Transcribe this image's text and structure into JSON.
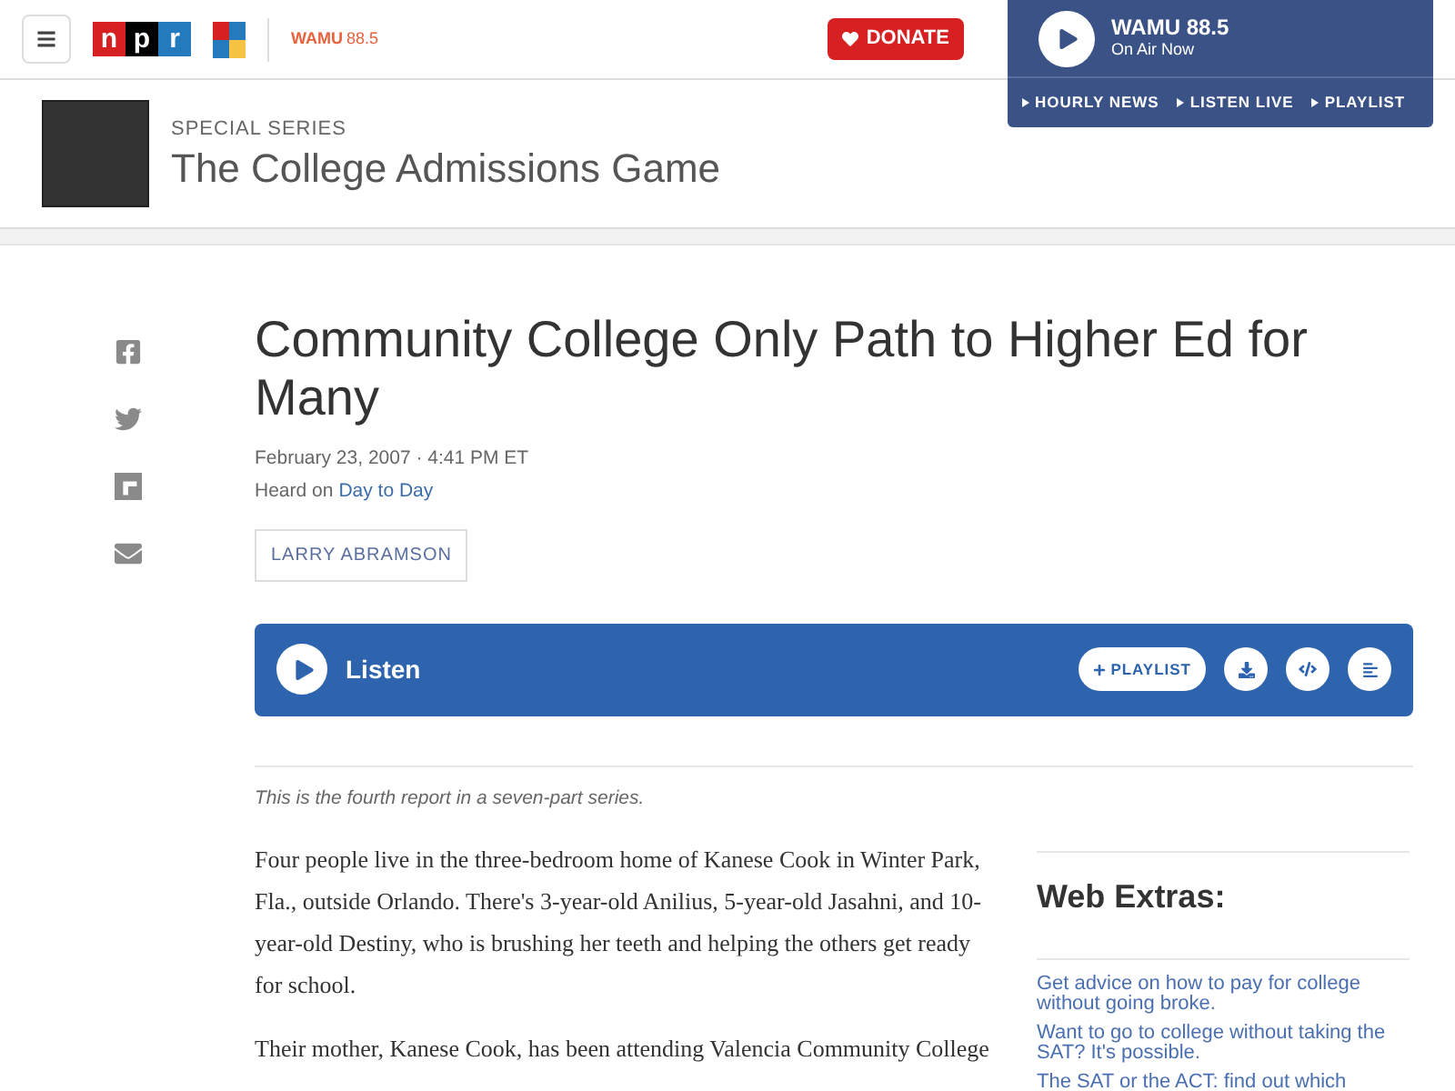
{
  "header": {
    "logo_letters": [
      "n",
      "p",
      "r"
    ],
    "station_logo": "WAMU",
    "station_freq": "88.5",
    "donate": "DONATE"
  },
  "player": {
    "station": "WAMU 88.5",
    "status": "On Air Now",
    "links": [
      "HOURLY NEWS",
      "LISTEN LIVE",
      "PLAYLIST"
    ]
  },
  "series": {
    "kicker": "SPECIAL SERIES",
    "title": "The College Admissions Game"
  },
  "share": [
    {
      "kind": "facebook"
    },
    {
      "kind": "twitter"
    },
    {
      "kind": "flipboard"
    },
    {
      "kind": "email"
    }
  ],
  "article": {
    "headline": "Community College Only Path to Higher Ed for Many",
    "date": "February 23, 2007 · 4:41 PM ET",
    "heard_prefix": "Heard on",
    "heard_show": "Day to Day",
    "byline": "LARRY ABRAMSON",
    "audio": {
      "label": "Listen",
      "playlist": "PLAYLIST"
    },
    "note": "This is the fourth report in a seven-part series.",
    "paragraphs": [
      "Four people live in the three-bedroom home of Kanese Cook in Winter Park, Fla., outside Orlando. There's 3-year-old Anilius, 5-year-old Jasahni, and 10-year-old Destiny, who is brushing her teeth and helping the others get ready for school.",
      "Their mother, Kanese Cook, has been attending Valencia Community College"
    ]
  },
  "web_extras": {
    "title": "Web Extras:",
    "links": [
      "Get advice on how to pay for college without going broke.",
      "Want to go to college without taking the SAT? It's possible.",
      "The SAT or the ACT: find out which"
    ]
  }
}
